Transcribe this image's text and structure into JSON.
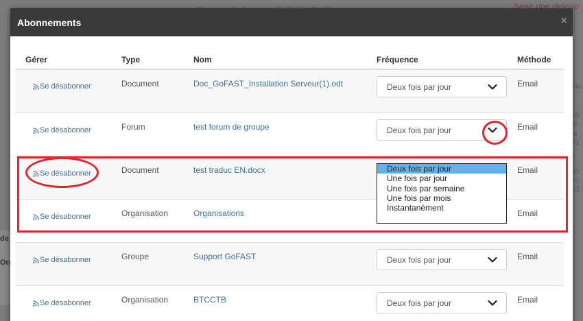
{
  "background": {
    "title": "Procédure GREIDE",
    "description_placeholder": "Saisir une descrip",
    "left_labels": [
      "de",
      "Org"
    ],
    "right_fragments": [
      "nu",
      "G",
      "F",
      "e",
      "G",
      "G",
      "G",
      "G"
    ]
  },
  "modal": {
    "title": "Abonnements",
    "close": "×"
  },
  "table": {
    "headers": {
      "manage": "Gérer",
      "type": "Type",
      "name": "Nom",
      "frequency": "Fréquence",
      "method": "Méthode"
    },
    "rows": [
      {
        "action": "Se désabonner",
        "type": "Document",
        "name": "Doc_GoFAST_Installation Serveur(1).odt",
        "frequency": "Deux fois par jour",
        "method": "Email"
      },
      {
        "action": "Se désabonner",
        "type": "Forum",
        "name": "test forum de groupe",
        "frequency": "Deux fois par jour",
        "method": "Email"
      },
      {
        "action": "Se désabonner",
        "type": "Document",
        "name": "test traduc EN.docx",
        "frequency": "Deux fois par jour",
        "method": "Email"
      },
      {
        "action": "Se désabonner",
        "type": "Organisation",
        "name": "Organisations",
        "frequency": "Deux fois par jour",
        "method": "Email"
      },
      {
        "action": "Se désabonner",
        "type": "Groupe",
        "name": "Support GoFAST",
        "frequency": "Deux fois par jour",
        "method": "Email"
      },
      {
        "action": "Se désabonner",
        "type": "Organisation",
        "name": "BTCCTB",
        "frequency": "Deux fois par jour",
        "method": "Email"
      }
    ]
  },
  "dropdown": {
    "options": [
      "Deux fois par jour",
      "Une fois par jour",
      "Une fois par semaine",
      "Une fois par mois",
      "Instantanément"
    ],
    "selected": "Deux fois par jour"
  },
  "colors": {
    "annotation": "#e8232a",
    "link": "#3a6fa5",
    "header_bg": "#3a3a3a",
    "selected_option": "#63b1e8"
  },
  "icons": {
    "unsubscribe": "rss-icon",
    "select_arrow": "chevron-down-icon",
    "close": "close-icon"
  }
}
